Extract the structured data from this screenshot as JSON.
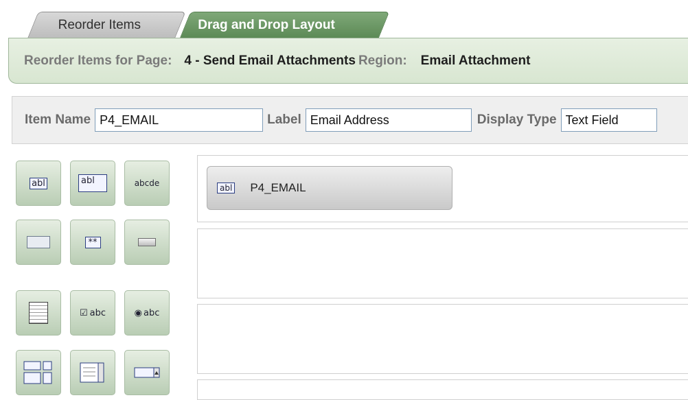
{
  "tabs": [
    {
      "label": "Reorder Items",
      "active": false
    },
    {
      "label": "Drag and Drop Layout",
      "active": true
    }
  ],
  "header": {
    "page_label": "Reorder Items for Page:",
    "page_value": "4 - Send Email Attachments",
    "region_label": "Region:",
    "region_value": "Email Attachment"
  },
  "properties": {
    "item_name_label": "Item Name",
    "item_name_value": "P4_EMAIL",
    "label_label": "Label",
    "label_value": "Email Address",
    "display_type_label": "Display Type",
    "display_type_value": "Text Field"
  },
  "palette": {
    "text_field": "abl",
    "textarea": "abl",
    "display_only": "abcde",
    "hidden": "",
    "password": "**",
    "button": "",
    "list": "",
    "checkbox": "abc",
    "radio": "abc",
    "shuttle": "",
    "select_list": "",
    "popup": ""
  },
  "layout": {
    "item_icon": "abl",
    "item_label": "P4_EMAIL"
  },
  "colors": {
    "active_tab": "#5c8a56",
    "header_bg": "#e0ebd9"
  }
}
